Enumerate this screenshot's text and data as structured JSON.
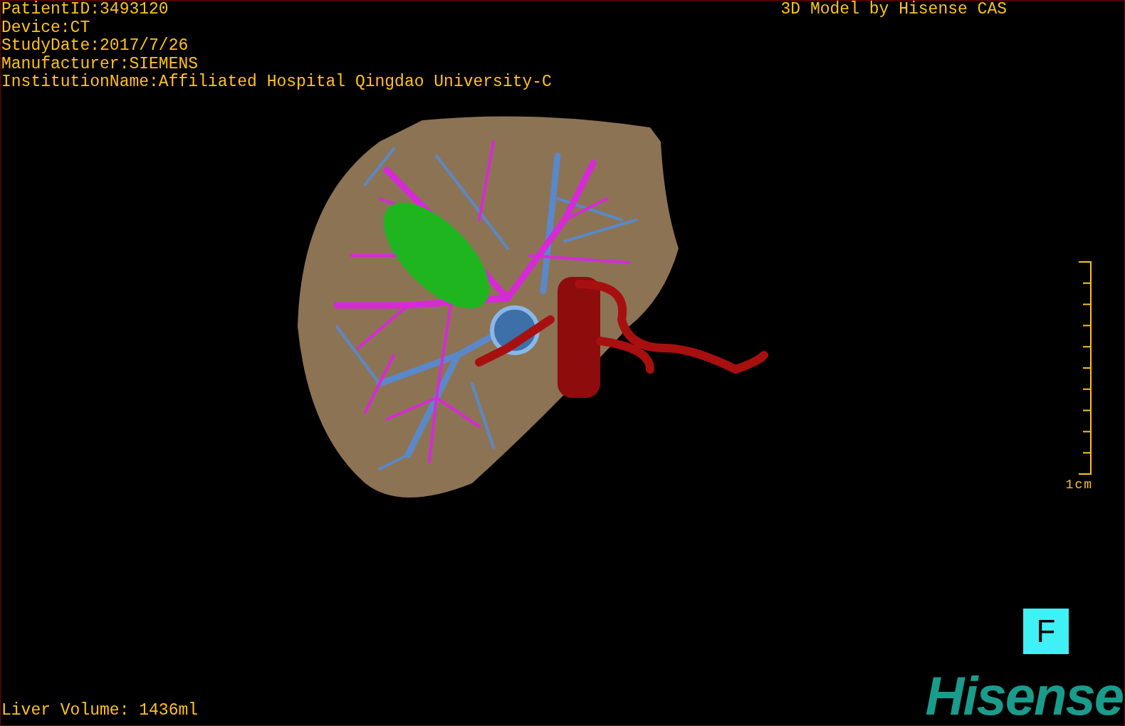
{
  "info_lines": [
    "PatientID:3493120",
    "Device:CT",
    "StudyDate:2017/7/26",
    "Manufacturer:SIEMENS",
    "InstitutionName:Affiliated Hospital Qingdao University-C"
  ],
  "model_credit": "3D Model by Hisense CAS",
  "scale_bar": {
    "label": "1cm"
  },
  "orientation_marker": "F",
  "logo": "Hisense",
  "liver_volume": "Liver Volume: 1436ml"
}
